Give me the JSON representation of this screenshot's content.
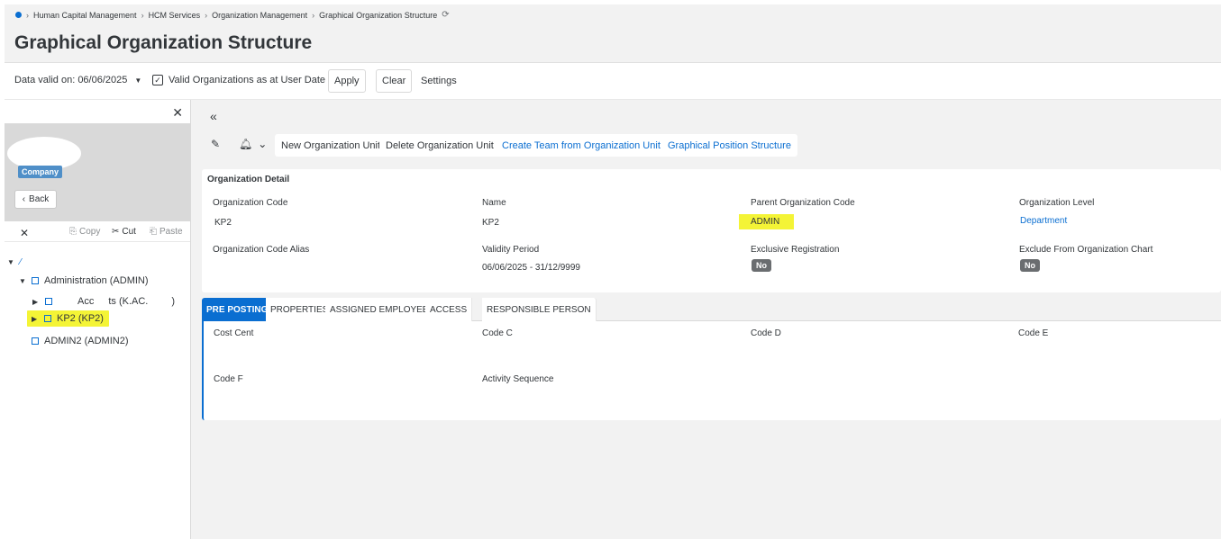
{
  "breadcrumb": {
    "items": [
      "Human Capital Management",
      "HCM Services",
      "Organization Management",
      "Graphical Organization Structure"
    ]
  },
  "page": {
    "title": "Graphical Organization Structure"
  },
  "filters": {
    "date_label": "Data valid on: 06/06/2025",
    "valid_check_label": "Valid Organizations as at User Date",
    "apply": "Apply",
    "clear": "Clear",
    "settings": "Settings"
  },
  "left": {
    "company_badge": "Company",
    "back": "Back",
    "copy": "Copy",
    "cut": "Cut",
    "paste": "Paste",
    "tree": {
      "admin": "Administration (ADMIN)",
      "acc_part1": "Acc",
      "acc_part2": "ts (K.AC.",
      "acc_part3": ")",
      "kp2": "KP2 (KP2)",
      "admin2": "ADMIN2 (ADMIN2)"
    }
  },
  "actions": {
    "new_org": "New Organization Unit",
    "delete_org": "Delete Organization Unit",
    "create_team": "Create Team from Organization Unit",
    "graphical_position": "Graphical Position Structure"
  },
  "detail": {
    "title": "Organization Detail",
    "org_code_label": "Organization Code",
    "org_code": "KP2",
    "name_label": "Name",
    "name": "KP2",
    "parent_label": "Parent Organization Code",
    "parent": "ADMIN",
    "level_label": "Organization Level",
    "level": "Department",
    "alias_label": "Organization Code Alias",
    "validity_label": "Validity Period",
    "validity": "06/06/2025 - 31/12/9999",
    "exclusive_label": "Exclusive Registration",
    "exclusive": "No",
    "exclude_label": "Exclude From Organization Chart",
    "exclude": "No"
  },
  "tabs": [
    "PRE POSTING",
    "PROPERTIES",
    "ASSIGNED EMPLOYEES",
    "ACCESS",
    "RESPONSIBLE PERSON"
  ],
  "preposting": {
    "cost_cent": "Cost Cent",
    "code_c": "Code C",
    "code_d": "Code D",
    "code_e": "Code E",
    "code_f": "Code F",
    "activity_sequence": "Activity Sequence"
  },
  "colors": {
    "accent": "#0a6ed1",
    "highlight": "#f4f436"
  }
}
